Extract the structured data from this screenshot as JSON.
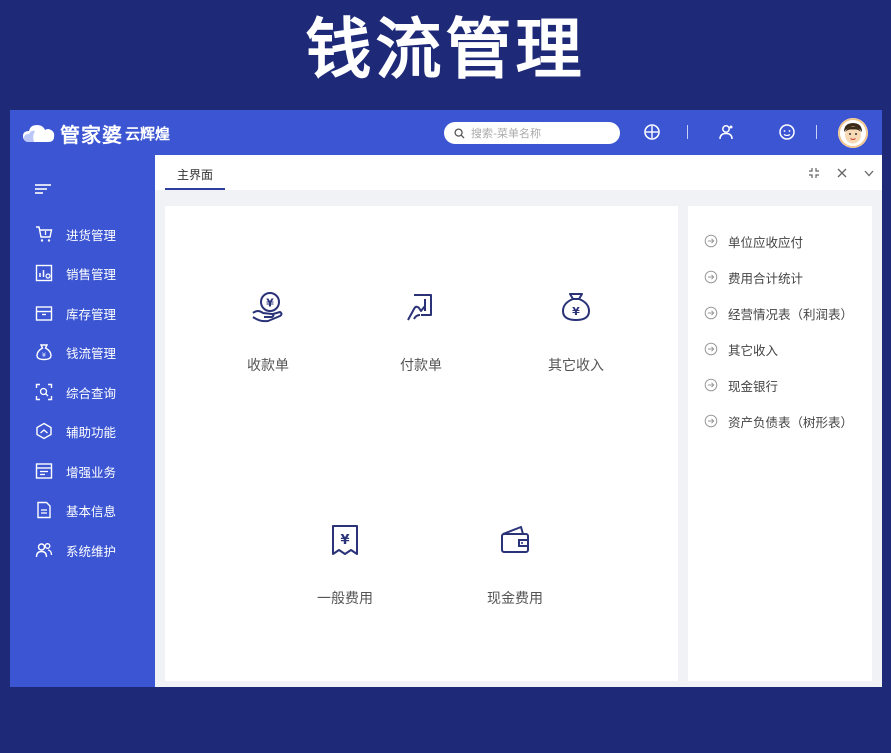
{
  "banner": {
    "title": "钱流管理"
  },
  "header": {
    "brand": "管家婆",
    "brand_sub": "云辉煌",
    "search_placeholder": "搜索-菜单名称"
  },
  "sidebar": {
    "items": [
      {
        "label": "进货管理",
        "icon": "cart-icon"
      },
      {
        "label": "销售管理",
        "icon": "sales-chart-icon"
      },
      {
        "label": "库存管理",
        "icon": "inventory-box-icon"
      },
      {
        "label": "钱流管理",
        "icon": "money-bag-icon"
      },
      {
        "label": "综合查询",
        "icon": "query-search-icon"
      },
      {
        "label": "辅助功能",
        "icon": "assist-hexagon-icon"
      },
      {
        "label": "增强业务",
        "icon": "enhance-card-icon"
      },
      {
        "label": "基本信息",
        "icon": "document-icon"
      },
      {
        "label": "系统维护",
        "icon": "users-maintenance-icon"
      }
    ]
  },
  "tabs": [
    {
      "label": "主界面"
    }
  ],
  "main": {
    "functions": [
      {
        "label": "收款单",
        "icon": "receive-money-icon"
      },
      {
        "label": "付款单",
        "icon": "payment-note-icon"
      },
      {
        "label": "其它收入",
        "icon": "income-bag-icon"
      },
      {
        "label": "一般费用",
        "icon": "expense-receipt-icon"
      },
      {
        "label": "现金费用",
        "icon": "cash-wallet-icon"
      }
    ]
  },
  "reports": {
    "items": [
      {
        "label": "单位应收应付"
      },
      {
        "label": "费用合计统计"
      },
      {
        "label": "经营情况表（利润表）"
      },
      {
        "label": "其它收入"
      },
      {
        "label": "现金银行"
      },
      {
        "label": "资产负债表（树形表）"
      }
    ]
  },
  "colors": {
    "background": "#1e2a78",
    "primary": "#3b55d3",
    "icon_dark": "#2a3278"
  }
}
